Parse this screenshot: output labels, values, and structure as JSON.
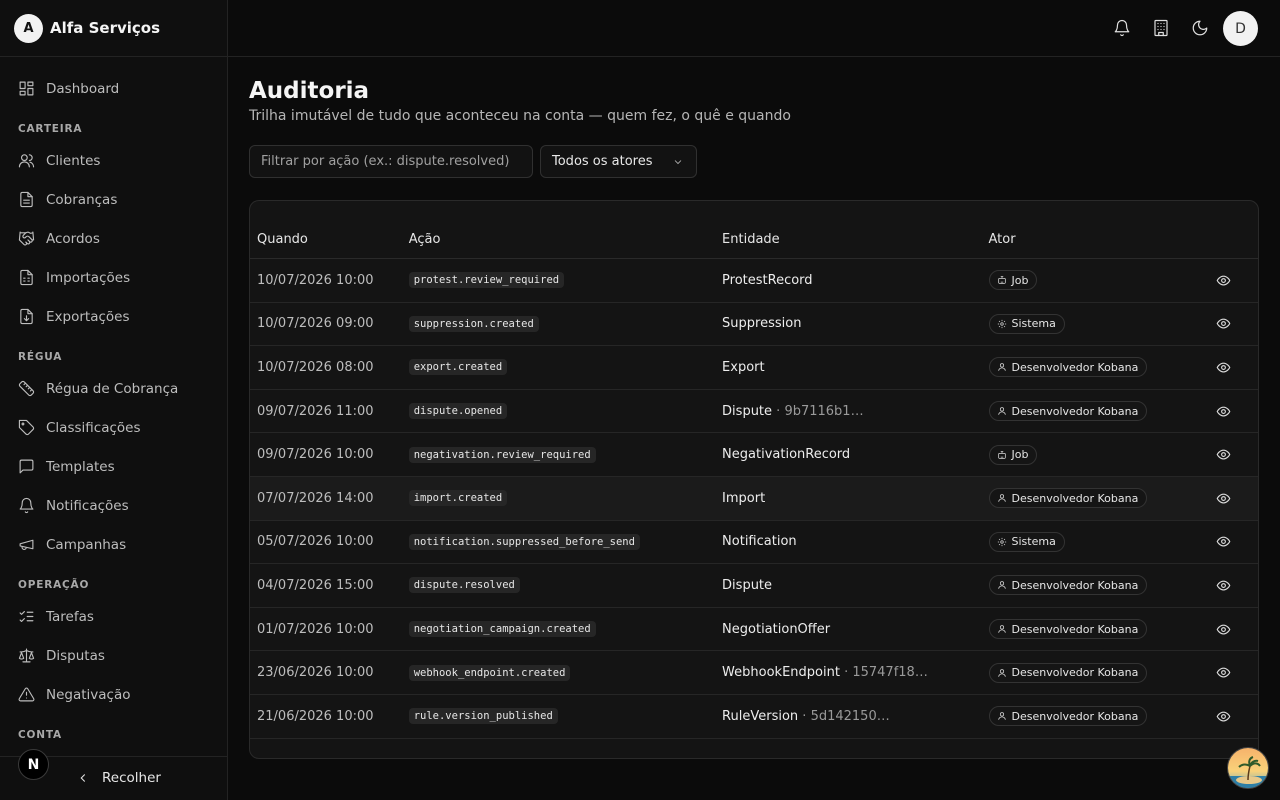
{
  "brand": {
    "logo_letter": "A",
    "name": "Alfa Serviços"
  },
  "sidebar": {
    "dashboard": "Dashboard",
    "sections": {
      "carteira": "CARTEIRA",
      "regua": "RÉGUA",
      "operacao": "OPERAÇÃO",
      "conta": "CONTA"
    },
    "carteira_items": [
      "Clientes",
      "Cobranças",
      "Acordos",
      "Importações",
      "Exportações"
    ],
    "regua_items": [
      "Régua de Cobrança",
      "Classificações",
      "Templates",
      "Notificações",
      "Campanhas"
    ],
    "operacao_items": [
      "Tarefas",
      "Disputas",
      "Negativação"
    ],
    "collapse_label": "Recolher",
    "n_badge": "N"
  },
  "header": {
    "avatar_letter": "D",
    "icons": [
      "bell-icon",
      "building-icon",
      "moon-icon"
    ]
  },
  "page": {
    "title": "Auditoria",
    "subtitle": "Trilha imutável de tudo que aconteceu na conta — quem fez, o quê e quando"
  },
  "filters": {
    "action_placeholder": "Filtrar por ação (ex.: dispute.resolved)",
    "actor_selected": "Todos os atores"
  },
  "table": {
    "headers": {
      "when": "Quando",
      "action": "Ação",
      "entity": "Entidade",
      "actor": "Ator"
    },
    "rows": [
      {
        "when": "10/07/2026 10:00",
        "action": "protest.review_required",
        "entity": "ProtestRecord",
        "entity_id": "",
        "actor": "Job",
        "actor_type": "job"
      },
      {
        "when": "10/07/2026 09:00",
        "action": "suppression.created",
        "entity": "Suppression",
        "entity_id": "",
        "actor": "Sistema",
        "actor_type": "system"
      },
      {
        "when": "10/07/2026 08:00",
        "action": "export.created",
        "entity": "Export",
        "entity_id": "",
        "actor": "Desenvolvedor Kobana",
        "actor_type": "user"
      },
      {
        "when": "09/07/2026 11:00",
        "action": "dispute.opened",
        "entity": "Dispute",
        "entity_id": "9b7116b1…",
        "actor": "Desenvolvedor Kobana",
        "actor_type": "user"
      },
      {
        "when": "09/07/2026 10:00",
        "action": "negativation.review_required",
        "entity": "NegativationRecord",
        "entity_id": "",
        "actor": "Job",
        "actor_type": "job"
      },
      {
        "when": "07/07/2026 14:00",
        "action": "import.created",
        "entity": "Import",
        "entity_id": "",
        "actor": "Desenvolvedor Kobana",
        "actor_type": "user",
        "highlight": true
      },
      {
        "when": "05/07/2026 10:00",
        "action": "notification.suppressed_before_send",
        "entity": "Notification",
        "entity_id": "",
        "actor": "Sistema",
        "actor_type": "system"
      },
      {
        "when": "04/07/2026 15:00",
        "action": "dispute.resolved",
        "entity": "Dispute",
        "entity_id": "",
        "actor": "Desenvolvedor Kobana",
        "actor_type": "user"
      },
      {
        "when": "01/07/2026 10:00",
        "action": "negotiation_campaign.created",
        "entity": "NegotiationOffer",
        "entity_id": "",
        "actor": "Desenvolvedor Kobana",
        "actor_type": "user"
      },
      {
        "when": "23/06/2026 10:00",
        "action": "webhook_endpoint.created",
        "entity": "WebhookEndpoint",
        "entity_id": "15747f18…",
        "actor": "Desenvolvedor Kobana",
        "actor_type": "user"
      },
      {
        "when": "21/06/2026 10:00",
        "action": "rule.version_published",
        "entity": "RuleVersion",
        "entity_id": "5d142150…",
        "actor": "Desenvolvedor Kobana",
        "actor_type": "user"
      }
    ]
  }
}
